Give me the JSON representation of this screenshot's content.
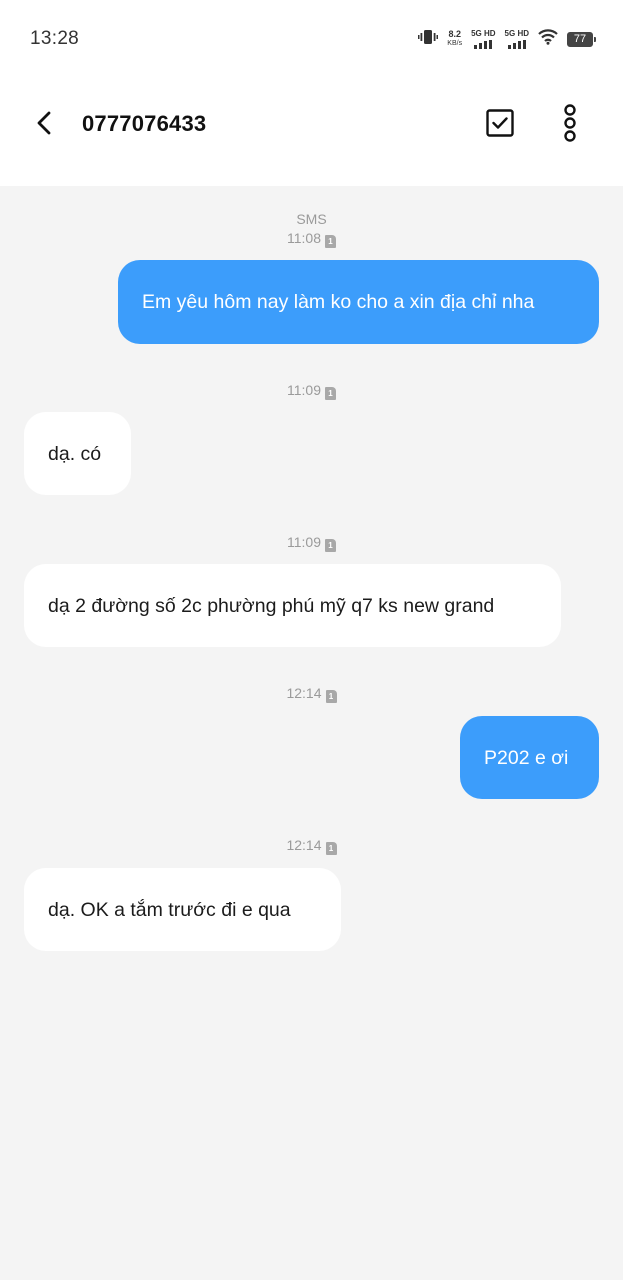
{
  "status_bar": {
    "time": "13:28",
    "net_speed_value": "8.2",
    "net_speed_unit": "KB/s",
    "sim1_label": "5G HD",
    "sim2_label": "5G HD",
    "battery": "77"
  },
  "header": {
    "title": "0777076433"
  },
  "thread": {
    "sms_label": "SMS",
    "messages": [
      {
        "time": "11:08",
        "direction": "out",
        "text": "Em yêu hôm nay làm ko cho a xin địa chỉ nha"
      },
      {
        "time": "11:09",
        "direction": "in",
        "text": "dạ. có"
      },
      {
        "time": "11:09",
        "direction": "in",
        "text": "dạ 2 đường số 2c phường phú mỹ q7 ks new grand"
      },
      {
        "time": "12:14",
        "direction": "out",
        "text": "P202 e ơi"
      },
      {
        "time": "12:14",
        "direction": "in",
        "text": "dạ. OK a tắm trước đi e qua"
      }
    ],
    "sim_badge": "1"
  },
  "colors": {
    "outgoing_bubble": "#3c9dfb",
    "incoming_bubble": "#ffffff",
    "thread_background": "#f4f4f4"
  },
  "icons": [
    "vibrate-icon",
    "signal-icon",
    "wifi-icon",
    "battery-icon",
    "back-arrow-icon",
    "select-checkbox-icon",
    "more-vertical-icon",
    "sim-card-icon"
  ]
}
